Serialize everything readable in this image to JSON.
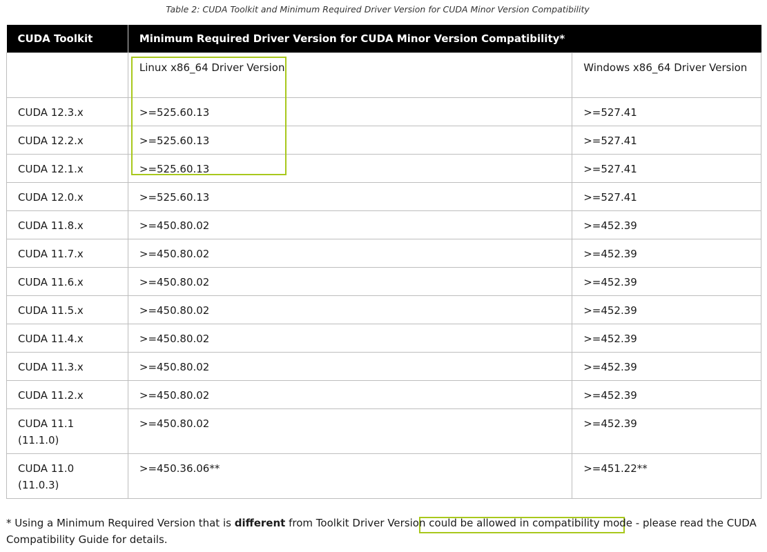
{
  "caption": "Table 2: CUDA Toolkit and Minimum Required Driver Version for CUDA Minor Version Compatibility",
  "table": {
    "headers": [
      "CUDA Toolkit",
      "Minimum Required Driver Version for CUDA Minor Version Compatibility*"
    ],
    "subheaders": [
      "",
      "Linux x86_64 Driver Version",
      "Windows x86_64 Driver Version"
    ],
    "rows": [
      {
        "toolkit": "CUDA 12.3.x",
        "linux": ">=525.60.13",
        "windows": ">=527.41"
      },
      {
        "toolkit": "CUDA 12.2.x",
        "linux": ">=525.60.13",
        "windows": ">=527.41"
      },
      {
        "toolkit": "CUDA 12.1.x",
        "linux": ">=525.60.13",
        "windows": ">=527.41"
      },
      {
        "toolkit": "CUDA 12.0.x",
        "linux": ">=525.60.13",
        "windows": ">=527.41"
      },
      {
        "toolkit": "CUDA 11.8.x",
        "linux": ">=450.80.02",
        "windows": ">=452.39"
      },
      {
        "toolkit": "CUDA 11.7.x",
        "linux": ">=450.80.02",
        "windows": ">=452.39"
      },
      {
        "toolkit": "CUDA 11.6.x",
        "linux": ">=450.80.02",
        "windows": ">=452.39"
      },
      {
        "toolkit": "CUDA 11.5.x",
        "linux": ">=450.80.02",
        "windows": ">=452.39"
      },
      {
        "toolkit": "CUDA 11.4.x",
        "linux": ">=450.80.02",
        "windows": ">=452.39"
      },
      {
        "toolkit": "CUDA 11.3.x",
        "linux": ">=450.80.02",
        "windows": ">=452.39"
      },
      {
        "toolkit": "CUDA 11.2.x",
        "linux": ">=450.80.02",
        "windows": ">=452.39"
      },
      {
        "toolkit": "CUDA 11.1 (11.1.0)",
        "linux": ">=450.80.02",
        "windows": ">=452.39"
      },
      {
        "toolkit": "CUDA 11.0 (11.0.3)",
        "linux": ">=450.36.06**",
        "windows": ">=451.22**"
      }
    ]
  },
  "footnote": {
    "prefix": "* Using a Minimum Required Version that is ",
    "bold": "different",
    "middle": " from Toolkit Driver Version ",
    "highlighted": "could be allowed in compatibility mode",
    "suffix": " - please read the CUDA Compatibility Guide for details."
  },
  "highlight_color": "#a8c81c"
}
